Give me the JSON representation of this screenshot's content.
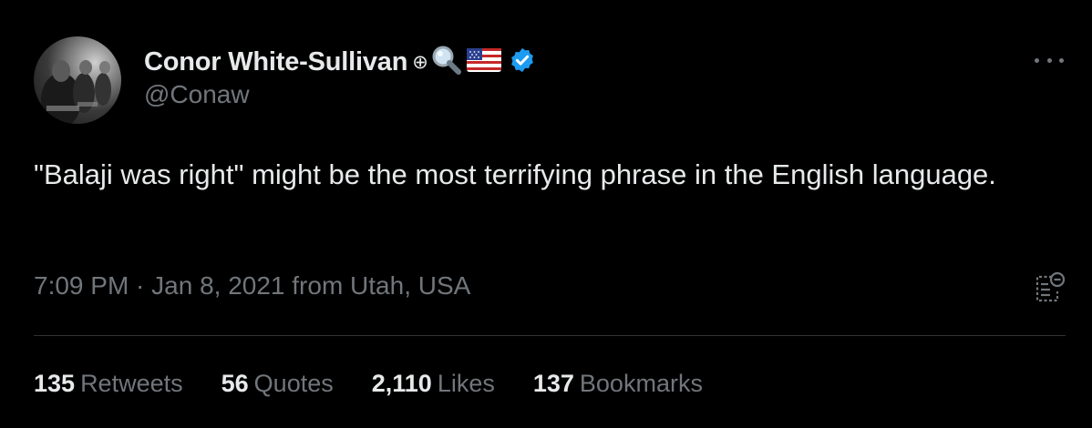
{
  "author": {
    "display_name": "Conor White-Sullivan",
    "name_glyph": "⊕",
    "handle": "@Conaw",
    "name_icons": [
      "magnifying-glass-emoji",
      "us-flag-emoji",
      "verified-badge"
    ]
  },
  "tweet": {
    "text": "\"Balaji was right\" might be the most terrifying phrase in the English language.",
    "timestamp": "7:09 PM · Jan 8, 2021 from Utah, USA"
  },
  "stats": [
    {
      "count": "135",
      "label": "Retweets"
    },
    {
      "count": "56",
      "label": "Quotes"
    },
    {
      "count": "2,110",
      "label": "Likes"
    },
    {
      "count": "137",
      "label": "Bookmarks"
    }
  ],
  "colors": {
    "background": "#000000",
    "primary_text": "#e7e9ea",
    "secondary_text": "#71767b",
    "verified_blue": "#1d9bf0",
    "divider": "#2f3336"
  }
}
